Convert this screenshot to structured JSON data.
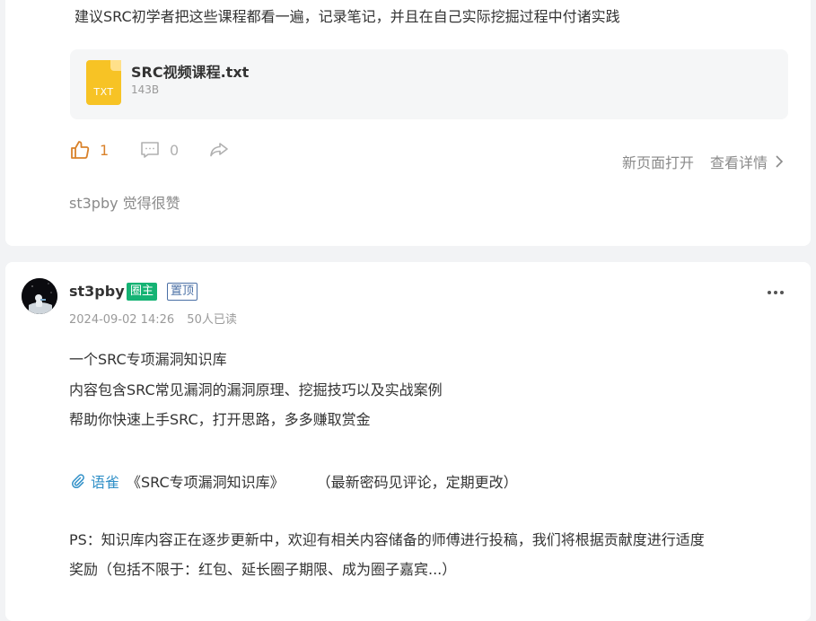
{
  "post1": {
    "body_line": "建议SRC初学者把这些课程都看一遍，记录笔记，并且在自己实际挖掘过程中付诸实践",
    "file": {
      "icon": "txt-file-icon",
      "type_label": "TXT",
      "name": "SRC视频课程.txt",
      "size": "143B"
    },
    "like_count": "1",
    "comment_count": "0",
    "open_new_page": "新页面打开",
    "view_details": "查看详情",
    "liked_by": "st3pby 觉得很赞"
  },
  "post2": {
    "author": "st3pby",
    "badge_owner": "圈主",
    "badge_pinned": "置顶",
    "date": "2024-09-02 14:26",
    "read_count": "50人已读",
    "lines": [
      "一个SRC专项漏洞知识库",
      "内容包含SRC常见漏洞的漏洞原理、挖掘技巧以及实战案例",
      "帮助你快速上手SRC，打开思路，多多赚取赏金"
    ],
    "link": {
      "icon": "paperclip-icon",
      "label": "语雀",
      "book": "《SRC专项漏洞知识库》",
      "note": "（最新密码见评论，定期更改）"
    },
    "ps_line1": "PS：知识库内容正在逐步更新中，欢迎有相关内容储备的师傅进行投稿，我们将根据贡献度进行适度",
    "ps_line2": "奖励（包括不限于：红包、延长圈子期限、成为圈子嘉宾...）"
  },
  "colors": {
    "background": "#f2f3f5",
    "like_active": "#d9822b",
    "link_blue": "#2f8fc7",
    "owner_badge": "#15b374",
    "file_icon": "#f7c325"
  }
}
